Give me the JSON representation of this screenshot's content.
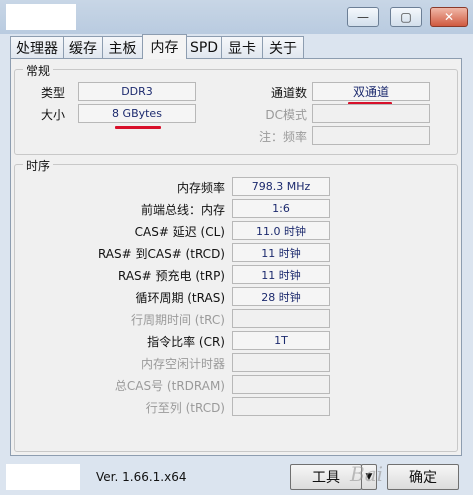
{
  "tabs": [
    "处理器",
    "缓存",
    "主板",
    "内存",
    "SPD",
    "显卡",
    "关于"
  ],
  "active_tab": 3,
  "general": {
    "title": "常规",
    "type_label": "类型",
    "type_value": "DDR3",
    "size_label": "大小",
    "size_value": "8 GBytes",
    "channels_label": "通道数",
    "channels_value": "双通道",
    "dc_mode_label": "DC模式",
    "dc_mode_value": "",
    "note_label": "注：频率",
    "note_value": ""
  },
  "timings": {
    "title": "时序",
    "rows": [
      {
        "label": "内存频率",
        "value": "798.3 MHz",
        "enabled": true
      },
      {
        "label": "前端总线：内存",
        "value": "1:6",
        "enabled": true
      },
      {
        "label": "CAS# 延迟 (CL)",
        "value": "11.0 时钟",
        "enabled": true
      },
      {
        "label": "RAS# 到CAS# (tRCD)",
        "value": "11 时钟",
        "enabled": true
      },
      {
        "label": "RAS# 预充电 (tRP)",
        "value": "11 时钟",
        "enabled": true
      },
      {
        "label": "循环周期 (tRAS)",
        "value": "28 时钟",
        "enabled": true
      },
      {
        "label": "行周期时间 (tRC)",
        "value": "",
        "enabled": false
      },
      {
        "label": "指令比率 (CR)",
        "value": "1T",
        "enabled": true
      },
      {
        "label": "内存空闲计时器",
        "value": "",
        "enabled": false
      },
      {
        "label": "总CAS号 (tRDRAM)",
        "value": "",
        "enabled": false
      },
      {
        "label": "行至列 (tRCD)",
        "value": "",
        "enabled": false
      }
    ]
  },
  "footer": {
    "version": "Ver. 1.66.1.x64",
    "tools_label": "工具",
    "dropdown_arrow": "▼",
    "ok_label": "确定",
    "watermark": "Bai"
  },
  "window_controls": {
    "minimize": "—",
    "maximize": "▢",
    "close": "✕"
  },
  "colors": {
    "value_text": "#1c2a6e",
    "highlight_underline": "#d8102a"
  }
}
